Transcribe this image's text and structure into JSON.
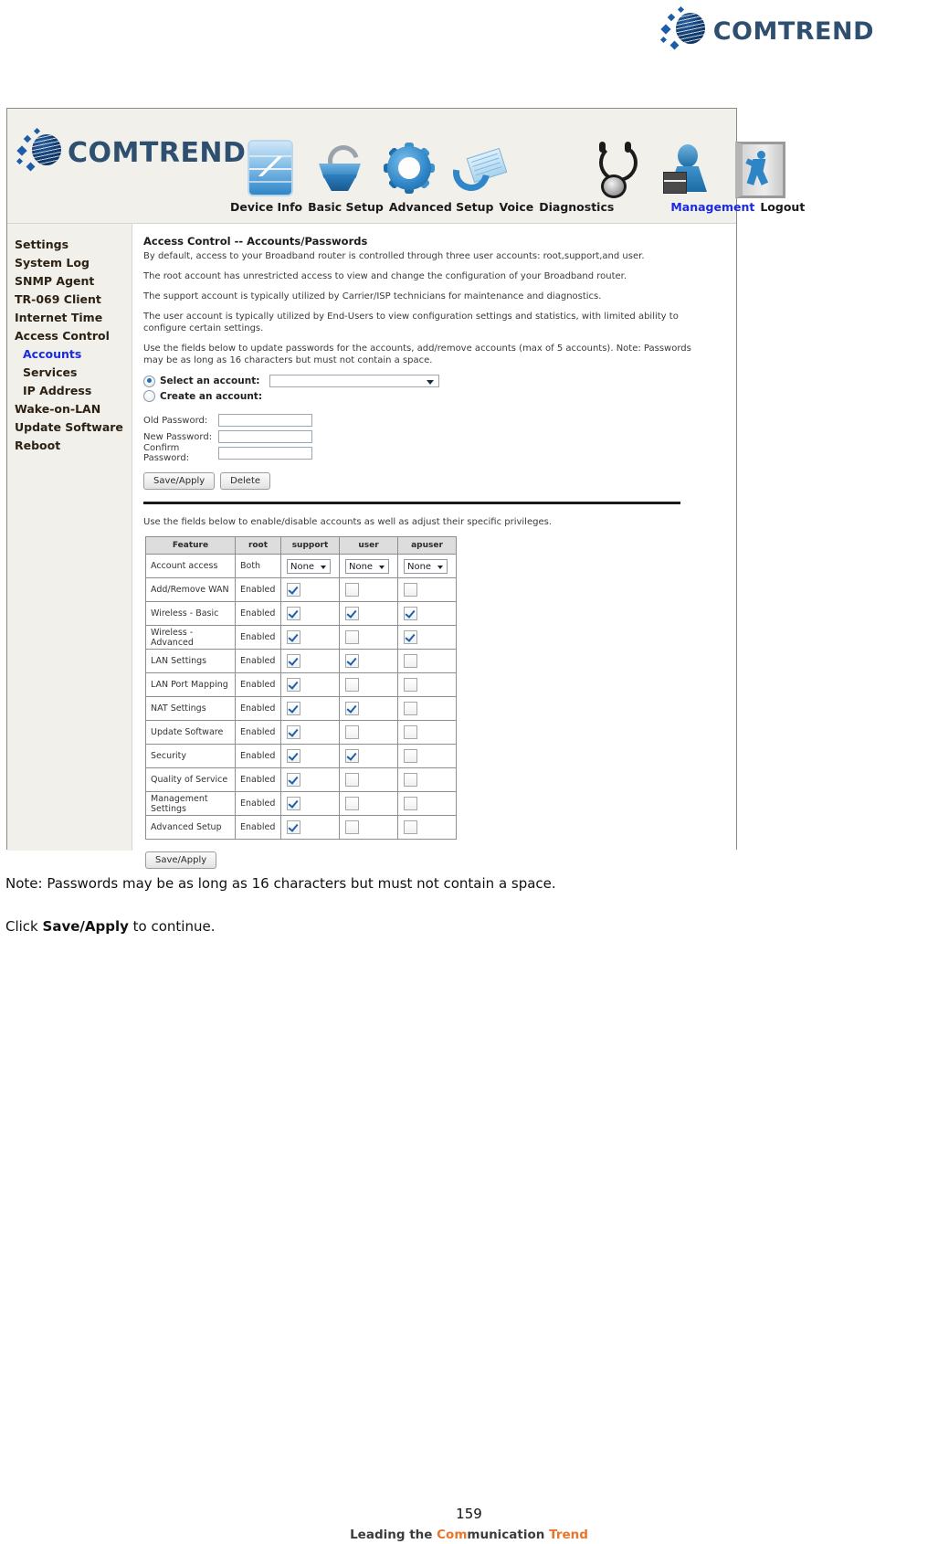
{
  "brand": {
    "name": "COMTREND",
    "logo_icon": "comtrend-globe-icon"
  },
  "router_ui": {
    "topnav": {
      "items": [
        {
          "label": "Device Info",
          "icon": "device-info-icon",
          "active": false
        },
        {
          "label": "Basic Setup",
          "icon": "basic-setup-icon",
          "active": false
        },
        {
          "label": "Advanced Setup",
          "icon": "advanced-setup-icon",
          "active": false
        },
        {
          "label": "Voice",
          "icon": "voice-icon",
          "active": false
        },
        {
          "label": "Diagnostics",
          "icon": "diagnostics-icon",
          "active": false
        },
        {
          "label": "Management",
          "icon": "management-icon",
          "active": true
        },
        {
          "label": "Logout",
          "icon": "logout-icon",
          "active": false
        }
      ]
    },
    "sidebar": {
      "items": [
        {
          "label": "Settings",
          "sub": false,
          "active": false
        },
        {
          "label": "System Log",
          "sub": false,
          "active": false
        },
        {
          "label": "SNMP Agent",
          "sub": false,
          "active": false
        },
        {
          "label": "TR-069 Client",
          "sub": false,
          "active": false
        },
        {
          "label": "Internet Time",
          "sub": false,
          "active": false
        },
        {
          "label": "Access Control",
          "sub": false,
          "active": false
        },
        {
          "label": "Accounts",
          "sub": true,
          "active": true
        },
        {
          "label": "Services",
          "sub": true,
          "active": false
        },
        {
          "label": "IP Address",
          "sub": true,
          "active": false
        },
        {
          "label": "Wake-on-LAN",
          "sub": false,
          "active": false
        },
        {
          "label": "Update Software",
          "sub": false,
          "active": false
        },
        {
          "label": "Reboot",
          "sub": false,
          "active": false
        }
      ]
    },
    "content": {
      "title": "Access Control -- Accounts/Passwords",
      "paragraphs": [
        "By default, access to your Broadband router is controlled through three user accounts: root,support,and user.",
        "The root account has unrestricted access to view and change the configuration of your Broadband router.",
        "The support account is typically utilized by Carrier/ISP technicians for maintenance and diagnostics.",
        "The user account is typically utilized by End-Users to view configuration settings and statistics, with limited ability to configure certain settings.",
        "Use the fields below to update passwords for the accounts, add/remove accounts (max of 5 accounts). Note: Passwords may be as long as 16 characters but must not contain a space."
      ],
      "account_mode": {
        "select_label": "Select an account:",
        "select_value": "",
        "create_label": "Create an account:",
        "selected": "select"
      },
      "password_fields": [
        {
          "label": "Old Password:",
          "value": ""
        },
        {
          "label": "New Password:",
          "value": ""
        },
        {
          "label": "Confirm Password:",
          "value": ""
        }
      ],
      "buttons": {
        "save_apply": "Save/Apply",
        "delete": "Delete",
        "save_apply_bottom": "Save/Apply"
      },
      "privileges_intro": "Use the fields below to enable/disable accounts as well as adjust their specific privileges.",
      "privileges_table": {
        "columns": [
          "Feature",
          "root",
          "support",
          "user",
          "apuser"
        ],
        "rows": [
          {
            "feature": "Account access",
            "root": "Both",
            "type": "select",
            "support": "None",
            "user": "None",
            "apuser": "None"
          },
          {
            "feature": "Add/Remove WAN",
            "root": "Enabled",
            "type": "checkbox",
            "support": true,
            "user": false,
            "apuser": false
          },
          {
            "feature": "Wireless - Basic",
            "root": "Enabled",
            "type": "checkbox",
            "support": true,
            "user": true,
            "apuser": true
          },
          {
            "feature": "Wireless - Advanced",
            "root": "Enabled",
            "type": "checkbox",
            "support": true,
            "user": false,
            "apuser": true
          },
          {
            "feature": "LAN Settings",
            "root": "Enabled",
            "type": "checkbox",
            "support": true,
            "user": true,
            "apuser": false
          },
          {
            "feature": "LAN Port Mapping",
            "root": "Enabled",
            "type": "checkbox",
            "support": true,
            "user": false,
            "apuser": false
          },
          {
            "feature": "NAT Settings",
            "root": "Enabled",
            "type": "checkbox",
            "support": true,
            "user": true,
            "apuser": false
          },
          {
            "feature": "Update Software",
            "root": "Enabled",
            "type": "checkbox",
            "support": true,
            "user": false,
            "apuser": false
          },
          {
            "feature": "Security",
            "root": "Enabled",
            "type": "checkbox",
            "support": true,
            "user": true,
            "apuser": false
          },
          {
            "feature": "Quality of Service",
            "root": "Enabled",
            "type": "checkbox",
            "support": true,
            "user": false,
            "apuser": false
          },
          {
            "feature": "Management Settings",
            "root": "Enabled",
            "type": "checkbox",
            "support": true,
            "user": false,
            "apuser": false
          },
          {
            "feature": "Advanced Setup",
            "root": "Enabled",
            "type": "checkbox",
            "support": true,
            "user": false,
            "apuser": false
          }
        ]
      }
    }
  },
  "document": {
    "note": "Note: Passwords may be as long as 16 characters but must not contain a space.",
    "click_prefix": "Click ",
    "click_bold": "Save/Apply",
    "click_suffix": " to continue.",
    "page_number": "159",
    "tagline_part1": "Leading the ",
    "tagline_orange1": "Com",
    "tagline_part2": "munication ",
    "tagline_orange2": "Trend"
  }
}
